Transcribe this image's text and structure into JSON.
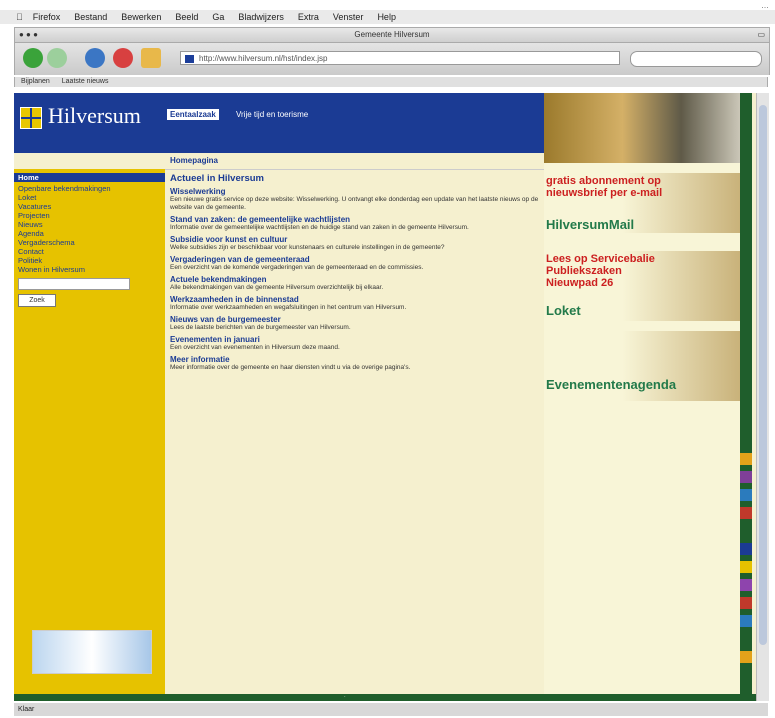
{
  "browser": {
    "menu": [
      "Firefox",
      "Bestand",
      "Bewerken",
      "Beeld",
      "Ga",
      "Bladwijzers",
      "Extra",
      "Venster",
      "Help"
    ],
    "window_title": "Gemeente Hilversum",
    "url": "http://www.hilversum.nl/hst/index.jsp",
    "bookmarks": [
      "Bijplanen",
      "Laatste nieuws"
    ],
    "status": "Klaar"
  },
  "site": {
    "logo": "Hilversum",
    "header_tab": "Eentaalzaak",
    "header_link": "Vrije tijd en toerisme",
    "subnav": "Homepagina",
    "sidebar": {
      "active": "Home",
      "items": [
        "Openbare bekendmakingen",
        "Loket",
        "Vacatures",
        "Projecten",
        "Nieuws",
        "Agenda",
        "Vergaderschema",
        "Contact",
        "Politiek",
        "Wonen in Hilversum"
      ],
      "button": "Zoek"
    },
    "main": {
      "title": "Actueel in Hilversum",
      "articles": [
        {
          "h": "Wisselwerking",
          "p": "Een nieuwe gratis service op deze website: Wisselwerking. U ontvangt elke donderdag een update van het laatste nieuws op de website van de gemeente."
        },
        {
          "h": "Stand van zaken: de gemeentelijke wachtlijsten",
          "p": "Informatie over de gemeentelijke wachtlijsten en de huidige stand van zaken in de gemeente Hilversum."
        },
        {
          "h": "Subsidie voor kunst en cultuur",
          "p": "Welke subsidies zijn er beschikbaar voor kunstenaars en culturele instellingen in de gemeente?"
        },
        {
          "h": "Vergaderingen van de gemeenteraad",
          "p": "Een overzicht van de komende vergaderingen van de gemeenteraad en de commissies."
        },
        {
          "h": "Actuele bekendmakingen",
          "p": "Alle bekendmakingen van de gemeente Hilversum overzichtelijk bij elkaar."
        },
        {
          "h": "Werkzaamheden in de binnenstad",
          "p": "Informatie over werkzaamheden en wegafsluitingen in het centrum van Hilversum."
        },
        {
          "h": "Nieuws van de burgemeester",
          "p": "Lees de laatste berichten van de burgemeester van Hilversum."
        },
        {
          "h": "Evenementen in januari",
          "p": "Een overzicht van evenementen in Hilversum deze maand."
        },
        {
          "h": "Meer informatie",
          "p": "Meer informatie over de gemeente en haar diensten vindt u via de overige pagina's."
        }
      ]
    },
    "right": {
      "block1": "gratis abonnement op nieuwsbrief per e-mail",
      "block1_title": "HilversumMail",
      "block2": "Lees op Servicebalie Publiekszaken Nieuwpad 26",
      "block2_title": "Loket",
      "block3_title": "Evenementenagenda"
    },
    "swatch_colors": [
      "#e3a21a",
      "#7f3f98",
      "#2b7bbd",
      "#c0392b",
      "#1f5e2c",
      "#1b3b94",
      "#e6c200",
      "#8e44ad",
      "#c0392b",
      "#2b7bbd",
      "#1f5e2c",
      "#e3a21a"
    ]
  }
}
